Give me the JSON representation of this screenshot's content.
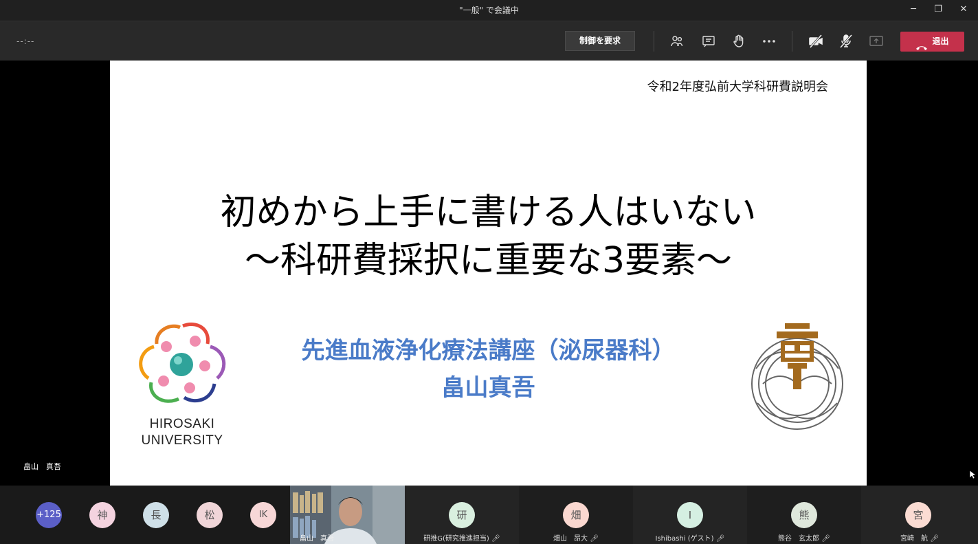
{
  "window": {
    "title": "\"一般\" で会議中",
    "minimize": "─",
    "restore": "❐",
    "close": "✕"
  },
  "toolbar": {
    "timer": "--:--",
    "request_control_label": "制御を要求",
    "leave_label": "退出",
    "icons": [
      "participants-icon",
      "chat-icon",
      "raise-hand-icon",
      "more-icon",
      "camera-off-icon",
      "mic-off-icon",
      "share-icon",
      "phone-icon"
    ],
    "leave_color": "#c4314b"
  },
  "slide": {
    "header": "令和2年度弘前大学科研費説明会",
    "title_line1": "初めから上手に書ける人はいない",
    "title_line2": "～科研費採択に重要な3要素～",
    "department": "先進血液浄化療法講座（泌尿器科）",
    "presenter": "畠山真吾",
    "logo_line1": "HIROSAKI",
    "logo_line2": "UNIVERSITY",
    "accent_color": "#4a7bc8",
    "seal_color": "#a36a1e"
  },
  "presenter_label": "畠山　真吾",
  "participants": {
    "overflow_count": "+125",
    "avatars": [
      {
        "initial": "神",
        "color": "#f4d3df"
      },
      {
        "initial": "長",
        "color": "#cfe0e8"
      },
      {
        "initial": "松",
        "color": "#f0d5d8"
      },
      {
        "initial": "IK",
        "color": "#f7d7d7"
      }
    ],
    "video": {
      "name": "畠山　真吾"
    },
    "tiles": [
      {
        "initial": "研",
        "name": "研推G(研究推進担当)",
        "color": "#d9efdf"
      },
      {
        "initial": "畑",
        "name": "畑山　昂大",
        "color": "#fad8d0"
      },
      {
        "initial": "I",
        "name": "Ishibashi (ゲスト)",
        "color": "#d5efe2"
      },
      {
        "initial": "熊",
        "name": "熊谷　玄太郎",
        "color": "#dfe8dc"
      },
      {
        "initial": "宮",
        "name": "宮崎　航",
        "color": "#fbdcd3"
      }
    ]
  }
}
